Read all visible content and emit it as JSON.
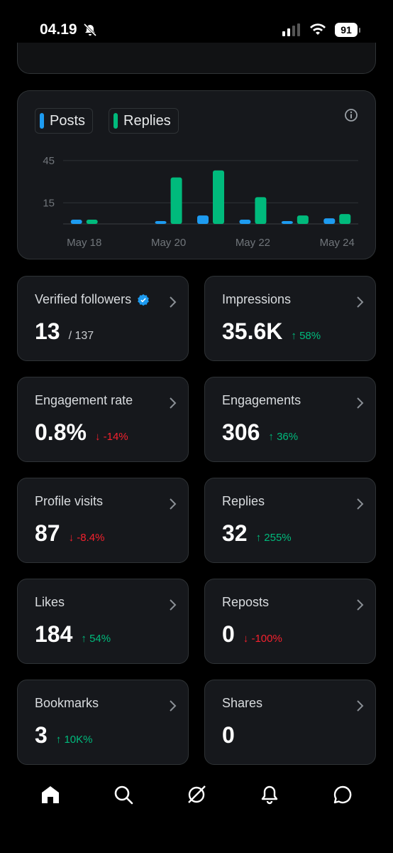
{
  "status_bar": {
    "time": "04.19",
    "battery": "91"
  },
  "chart": {
    "legend": [
      {
        "label": "Posts",
        "color": "#1d9bf0"
      },
      {
        "label": "Replies",
        "color": "#00ba7c"
      }
    ]
  },
  "chart_data": {
    "type": "bar",
    "categories": [
      "May 18",
      "May 19",
      "May 20",
      "May 21",
      "May 22",
      "May 23",
      "May 24"
    ],
    "x_tick_labels": [
      "May 18",
      "May 20",
      "May 22",
      "May 24"
    ],
    "y_ticks": [
      "45",
      "15"
    ],
    "ylim": [
      0,
      52
    ],
    "series": [
      {
        "name": "Posts",
        "color": "#1d9bf0",
        "values": [
          3,
          0,
          2,
          6,
          3,
          2,
          4
        ]
      },
      {
        "name": "Replies",
        "color": "#00ba7c",
        "values": [
          3,
          0,
          33,
          38,
          19,
          6,
          7
        ]
      }
    ],
    "grid": true
  },
  "metrics": [
    {
      "label": "Verified followers",
      "value": "13",
      "sub": "/ 137",
      "verified": true
    },
    {
      "label": "Impressions",
      "value": "35.6K",
      "delta": "58%",
      "dir": "up"
    },
    {
      "label": "Engagement rate",
      "value": "0.8%",
      "delta": "-14%",
      "dir": "down"
    },
    {
      "label": "Engagements",
      "value": "306",
      "delta": "36%",
      "dir": "up"
    },
    {
      "label": "Profile visits",
      "value": "87",
      "delta": "-8.4%",
      "dir": "down"
    },
    {
      "label": "Replies",
      "value": "32",
      "delta": "255%",
      "dir": "up"
    },
    {
      "label": "Likes",
      "value": "184",
      "delta": "54%",
      "dir": "up"
    },
    {
      "label": "Reposts",
      "value": "0",
      "delta": "-100%",
      "dir": "down"
    },
    {
      "label": "Bookmarks",
      "value": "3",
      "delta": "10K%",
      "dir": "up"
    },
    {
      "label": "Shares",
      "value": "0"
    }
  ],
  "nav": [
    "home-icon",
    "search-icon",
    "grok-icon",
    "bell-icon",
    "messages-icon"
  ]
}
